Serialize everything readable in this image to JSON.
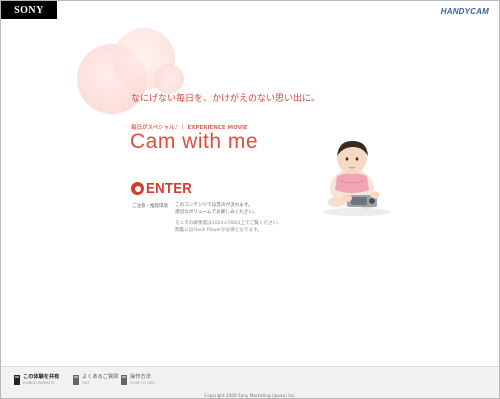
{
  "header": {
    "brand": "SONY",
    "product_logo": "HANDYCAM"
  },
  "hero": {
    "tagline": "なにげない毎日を、かけがえのない思い出に。",
    "subtitle": "毎日がスペシャル♪ ｜ EXPERIENCE MOVIE",
    "title": "Cam with me",
    "enter_label": "ENTER"
  },
  "notice": {
    "label": "ご注意・推奨環境",
    "lines": [
      "このコンテンツでは音声が流れます。",
      "適切なボリュームでお楽しみください。"
    ],
    "requirements": [
      "モニタの解像度は1024×768以上でご覧ください。",
      "閲覧にはFlash Playerが必要となります。"
    ]
  },
  "footer": {
    "items": [
      {
        "label": "この体験を共有",
        "sub": "EMBED WEBSITE",
        "icon": "share-icon"
      },
      {
        "label": "よくあるご質問",
        "sub": "FAQ",
        "icon": "faq-icon"
      },
      {
        "label": "操作方法",
        "sub": "HOW TO USE",
        "icon": "howto-icon"
      }
    ],
    "copyright": "Copyright 2009 Sony Marketing (Japan) Inc."
  },
  "colors": {
    "accent": "#d73b2f",
    "title": "#e24b3f",
    "brand_bar": "#000000",
    "logo": "#3a5f9a"
  }
}
